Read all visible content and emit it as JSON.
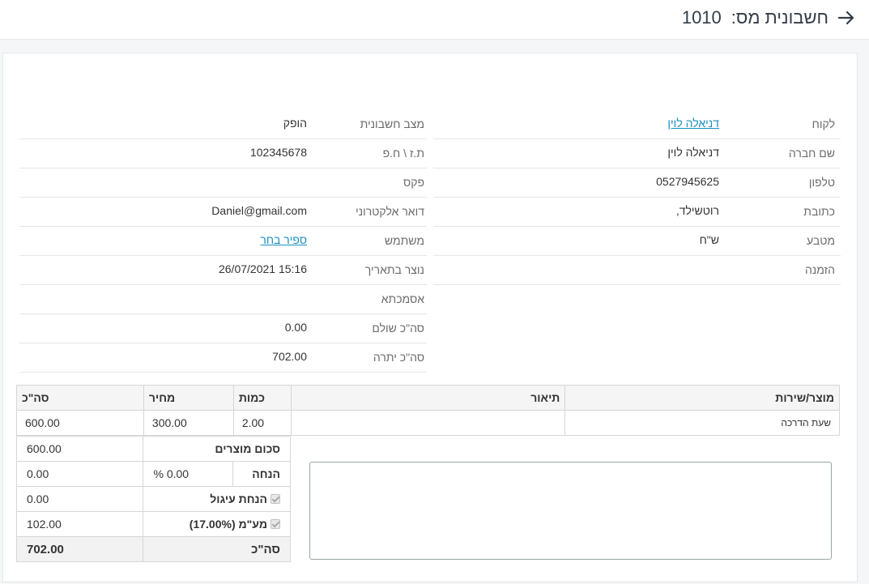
{
  "header": {
    "title": "חשבונית מס:",
    "number": "1010"
  },
  "right_fields": [
    {
      "label": "לקוח",
      "value": "דניאלה לוין",
      "link": true
    },
    {
      "label": "שם חברה",
      "value": "דניאלה לוין"
    },
    {
      "label": "טלפון",
      "value": "0527945625"
    },
    {
      "label": "כתובת",
      "value": "רוטשילד,"
    },
    {
      "label": "מטבע",
      "value": "ש\"ח"
    },
    {
      "label": "הזמנה",
      "value": ""
    }
  ],
  "left_fields": [
    {
      "label": "מצב חשבונית",
      "value": "הופק"
    },
    {
      "label": "ת.ז \\ ח.פ",
      "value": "102345678"
    },
    {
      "label": "פקס",
      "value": ""
    },
    {
      "label": "דואר אלקטרוני",
      "value": "Daniel@gmail.com"
    },
    {
      "label": "משתמש",
      "value": "ספיר בחר",
      "link": true
    },
    {
      "label": "נוצר בתאריך",
      "value": "15:16 26/07/2021"
    },
    {
      "label": "אסמכתא",
      "value": ""
    },
    {
      "label": "סה\"כ שולם",
      "value": "0.00"
    },
    {
      "label": "סה\"כ יתרה",
      "value": "702.00"
    }
  ],
  "items_table": {
    "headers": {
      "product": "מוצר/שירות",
      "description": "תיאור",
      "qty": "כמות",
      "price": "מחיר",
      "total": "סה\"כ"
    },
    "rows": [
      {
        "product": "שעת הדרכה",
        "description": "",
        "qty": "2.00",
        "price": "300.00",
        "total": "600.00"
      }
    ]
  },
  "totals": {
    "products_sum_label": "סכום מוצרים",
    "products_sum": "600.00",
    "discount_label": "הנחה",
    "discount_percent": "0.00 %",
    "discount_value": "0.00",
    "rounding_label": "הנחת עיגול",
    "rounding_value": "0.00",
    "vat_label": "מע\"מ (17.00%)",
    "vat_value": "102.00",
    "grand_total_label": "סה\"כ",
    "grand_total": "702.00"
  },
  "colors": {
    "link": "#1a8fc4",
    "label": "#6b6b6b",
    "border": "#d6d6d6",
    "title": "#333d47"
  },
  "icons": {
    "back": "arrow-right-icon",
    "checkbox": "checkbox-checked-icon"
  }
}
